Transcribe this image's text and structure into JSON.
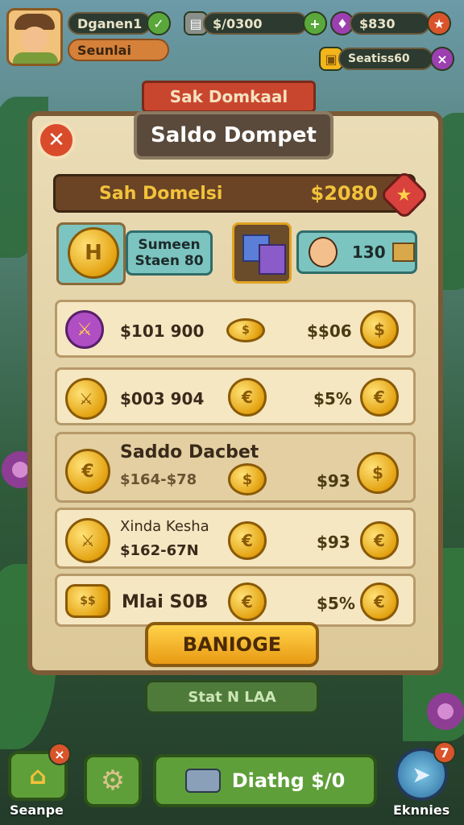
{
  "hud": {
    "player_name": "Dganen1",
    "player_title": "Seunlai",
    "currency1": "$/0300",
    "currency2": "$830",
    "status": "Seatiss60"
  },
  "panel": {
    "ribbon": "Sak Domkaal",
    "title": "Saldo Dompet",
    "close": "✕",
    "wallet_label": "Sah Domelsi",
    "wallet_value": "$2080",
    "teal_card": {
      "line1": "Sumeen",
      "line2": "Staen 80"
    },
    "profile_value": "130"
  },
  "rows": [
    {
      "left": "$101 900",
      "right": "$$06"
    },
    {
      "left": "$003 904",
      "right": "$5%"
    },
    {
      "title": "Saddo Dacbet",
      "left": "$164-$78",
      "right": "$93"
    },
    {
      "title": "Xinda Kesha",
      "left": "$162-67N",
      "right": "$93"
    },
    {
      "left": "Mlai S0B",
      "right": "$5%"
    }
  ],
  "actions": {
    "primary": "BANIOGE",
    "secondary": "Stat N LAA"
  },
  "bottom": {
    "home_label": "Seanpe",
    "home_badge": "×",
    "settings_icon": "gear-icon",
    "main_label": "Diathg $/0",
    "compass_label": "Eknnies",
    "compass_badge": "7"
  },
  "colors": {
    "panel": "#eadcb6",
    "accent_red": "#d9542b",
    "gold": "#f2b51b",
    "green": "#5aa83b"
  }
}
